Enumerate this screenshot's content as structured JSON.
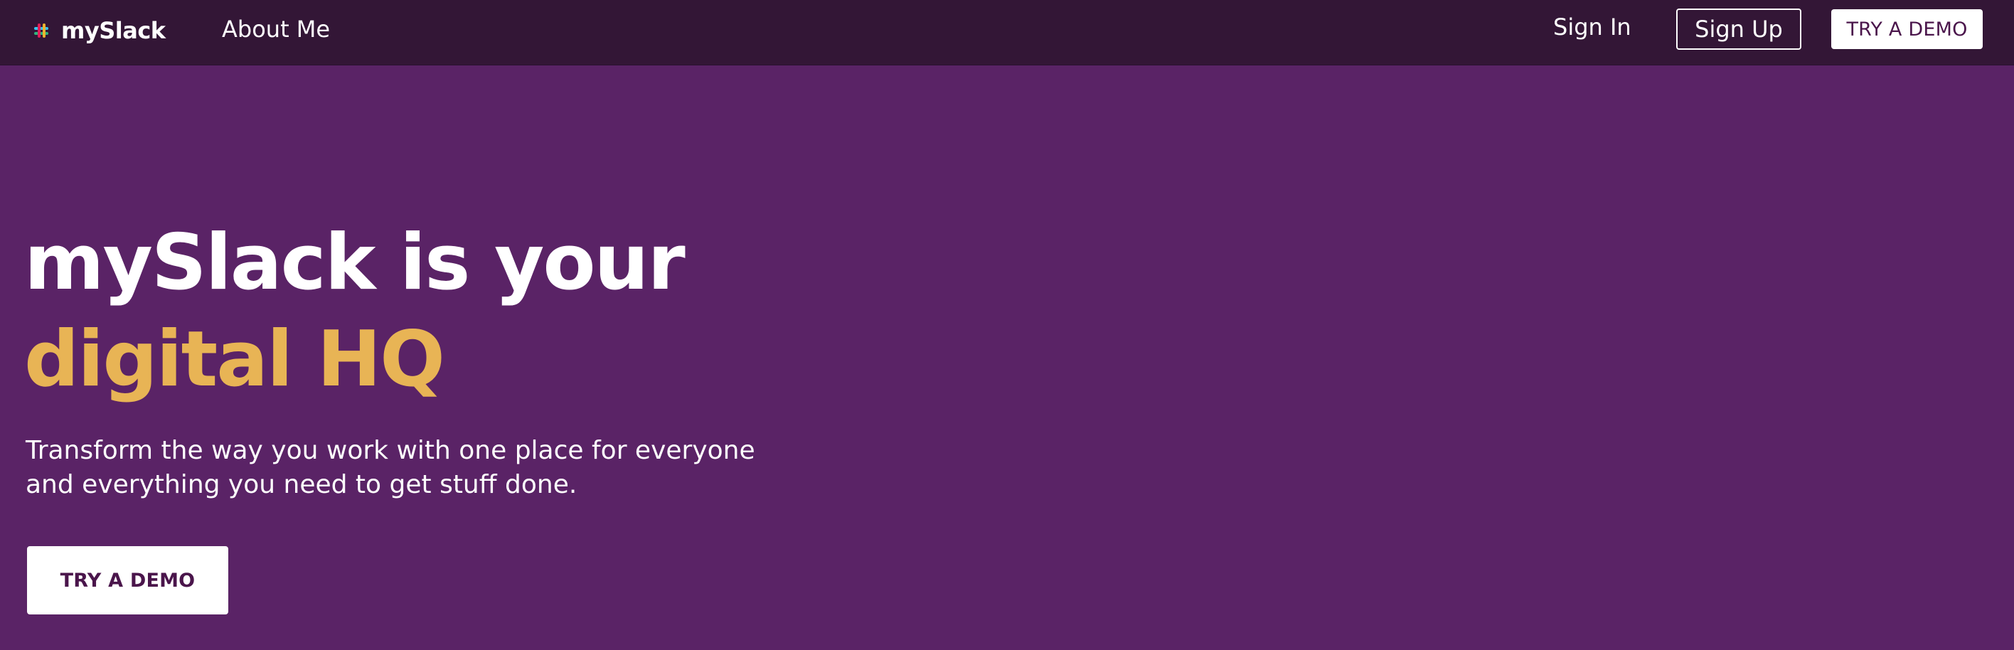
{
  "nav": {
    "brand_name": "mySlack",
    "brand_icon": "slack-hash-logo-icon",
    "about_label": "About Me",
    "signin_label": "Sign In",
    "signup_label": "Sign Up",
    "demo_label": "TRY A DEMO"
  },
  "hero": {
    "headline_line1": "mySlack is your",
    "headline_line2": "digital HQ",
    "subtext": "Transform the way you work with one place for everyone and everything you need to get stuff done.",
    "cta_label": "TRY A DEMO"
  },
  "colors": {
    "nav_bg": "#331636",
    "hero_bg": "#5a2366",
    "accent_gold": "#e8b455",
    "button_text": "#4a154b"
  }
}
